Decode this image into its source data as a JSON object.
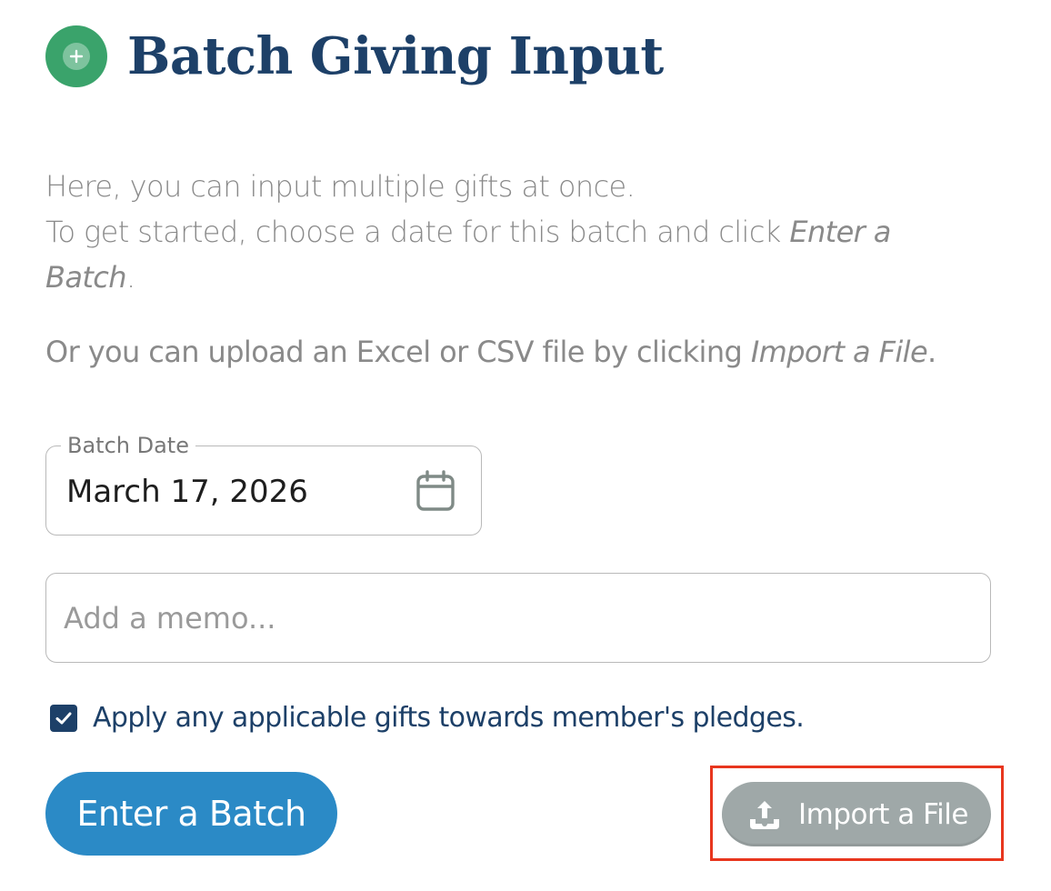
{
  "header": {
    "title": "Batch Giving Input",
    "icon": "plus-circle-icon",
    "icon_color": "#3aa36b",
    "title_color": "#1d4068"
  },
  "intro": {
    "line1": "Here, you can input multiple gifts at once.",
    "line2_prefix": "To get started, choose a date for this batch and click ",
    "line2_emphasis": "Enter a Batch",
    "line2_suffix": "."
  },
  "upload_hint": {
    "prefix": "Or you can upload an Excel or CSV file by clicking ",
    "emphasis": "Import a File",
    "suffix": "."
  },
  "batch_date": {
    "label": "Batch Date",
    "value": "March 17, 2026",
    "icon": "calendar-icon"
  },
  "memo": {
    "placeholder": "Add a memo..."
  },
  "pledge_option": {
    "label": "Apply any applicable gifts towards member's pledges.",
    "checked": true
  },
  "actions": {
    "enter_batch_label": "Enter a Batch",
    "import_file_label": "Import a File",
    "import_icon": "upload-icon",
    "enter_color": "#2b8ac6",
    "import_color": "#9fa8a8",
    "highlight_color": "#e8361e"
  }
}
